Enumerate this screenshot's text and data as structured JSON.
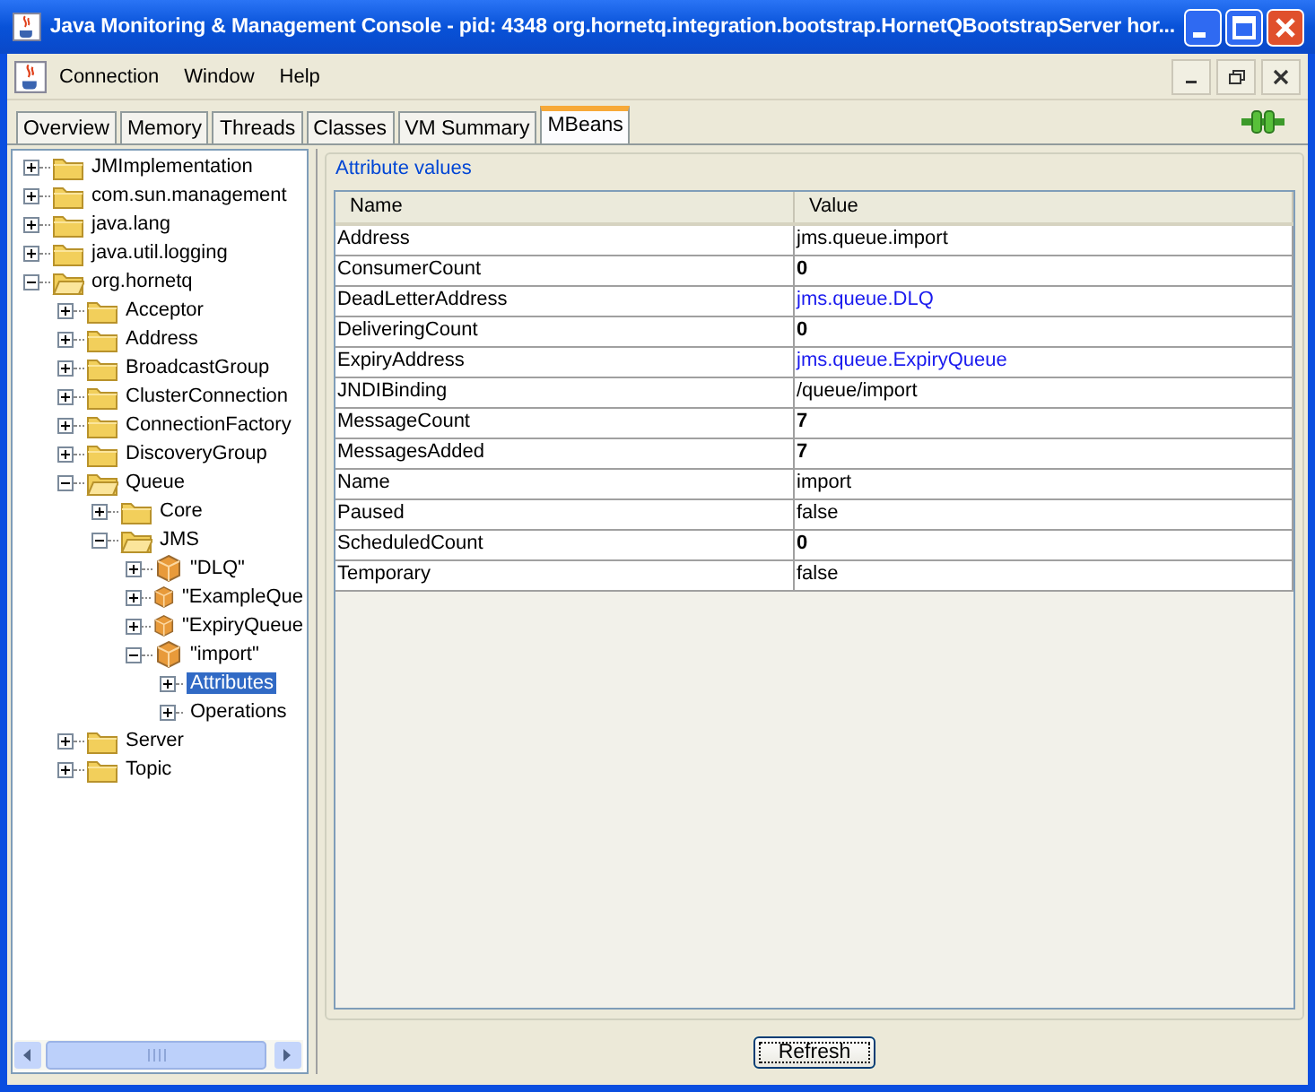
{
  "window": {
    "title": "Java Monitoring & Management Console - pid: 4348 org.hornetq.integration.bootstrap.HornetQBootstrapServer hor..."
  },
  "menu": [
    "Connection",
    "Window",
    "Help"
  ],
  "tabs": [
    {
      "label": "Overview",
      "selected": false
    },
    {
      "label": "Memory",
      "selected": false
    },
    {
      "label": "Threads",
      "selected": false
    },
    {
      "label": "Classes",
      "selected": false
    },
    {
      "label": "VM Summary",
      "selected": false
    },
    {
      "label": "MBeans",
      "selected": true
    }
  ],
  "tree": [
    {
      "label": "JMImplementation",
      "kind": "folder",
      "expanded": false,
      "selected": false
    },
    {
      "label": "com.sun.management",
      "kind": "folder",
      "expanded": false,
      "selected": false
    },
    {
      "label": "java.lang",
      "kind": "folder",
      "expanded": false,
      "selected": false
    },
    {
      "label": "java.util.logging",
      "kind": "folder",
      "expanded": false,
      "selected": false
    },
    {
      "label": "org.hornetq",
      "kind": "folder",
      "expanded": true,
      "selected": false,
      "children": [
        {
          "label": "Acceptor",
          "kind": "folder",
          "expanded": false,
          "selected": false
        },
        {
          "label": "Address",
          "kind": "folder",
          "expanded": false,
          "selected": false
        },
        {
          "label": "BroadcastGroup",
          "kind": "folder",
          "expanded": false,
          "selected": false
        },
        {
          "label": "ClusterConnection",
          "kind": "folder",
          "expanded": false,
          "selected": false
        },
        {
          "label": "ConnectionFactory",
          "kind": "folder",
          "expanded": false,
          "selected": false
        },
        {
          "label": "DiscoveryGroup",
          "kind": "folder",
          "expanded": false,
          "selected": false
        },
        {
          "label": "Queue",
          "kind": "folder",
          "expanded": true,
          "selected": false,
          "children": [
            {
              "label": "Core",
              "kind": "folder",
              "expanded": false,
              "selected": false
            },
            {
              "label": "JMS",
              "kind": "folder",
              "expanded": true,
              "selected": false,
              "children": [
                {
                  "label": "\"DLQ\"",
                  "kind": "mbean",
                  "expanded": false,
                  "selected": false
                },
                {
                  "label": "\"ExampleQue",
                  "kind": "mbean",
                  "expanded": false,
                  "selected": false
                },
                {
                  "label": "\"ExpiryQueue",
                  "kind": "mbean",
                  "expanded": false,
                  "selected": false
                },
                {
                  "label": "\"import\"",
                  "kind": "mbean",
                  "expanded": true,
                  "selected": false,
                  "children": [
                    {
                      "label": "Attributes",
                      "kind": "leaf",
                      "expanded": false,
                      "selected": true
                    },
                    {
                      "label": "Operations",
                      "kind": "leaf",
                      "expanded": false,
                      "selected": false
                    }
                  ]
                }
              ]
            }
          ]
        },
        {
          "label": "Server",
          "kind": "folder",
          "expanded": false,
          "selected": false
        },
        {
          "label": "Topic",
          "kind": "folder",
          "expanded": false,
          "selected": false
        }
      ]
    }
  ],
  "attributes": {
    "title": "Attribute values",
    "columns": [
      "Name",
      "Value"
    ],
    "rows": [
      {
        "name": "Address",
        "value": "jms.queue.import",
        "kind": "text"
      },
      {
        "name": "ConsumerCount",
        "value": "0",
        "kind": "number"
      },
      {
        "name": "DeadLetterAddress",
        "value": "jms.queue.DLQ",
        "kind": "link"
      },
      {
        "name": "DeliveringCount",
        "value": "0",
        "kind": "number"
      },
      {
        "name": "ExpiryAddress",
        "value": "jms.queue.ExpiryQueue",
        "kind": "link"
      },
      {
        "name": "JNDIBinding",
        "value": "/queue/import",
        "kind": "text"
      },
      {
        "name": "MessageCount",
        "value": "7",
        "kind": "number"
      },
      {
        "name": "MessagesAdded",
        "value": "7",
        "kind": "number"
      },
      {
        "name": "Name",
        "value": "import",
        "kind": "text"
      },
      {
        "name": "Paused",
        "value": "false",
        "kind": "text"
      },
      {
        "name": "ScheduledCount",
        "value": "0",
        "kind": "number"
      },
      {
        "name": "Temporary",
        "value": "false",
        "kind": "text"
      }
    ]
  },
  "refresh_button": "Refresh"
}
